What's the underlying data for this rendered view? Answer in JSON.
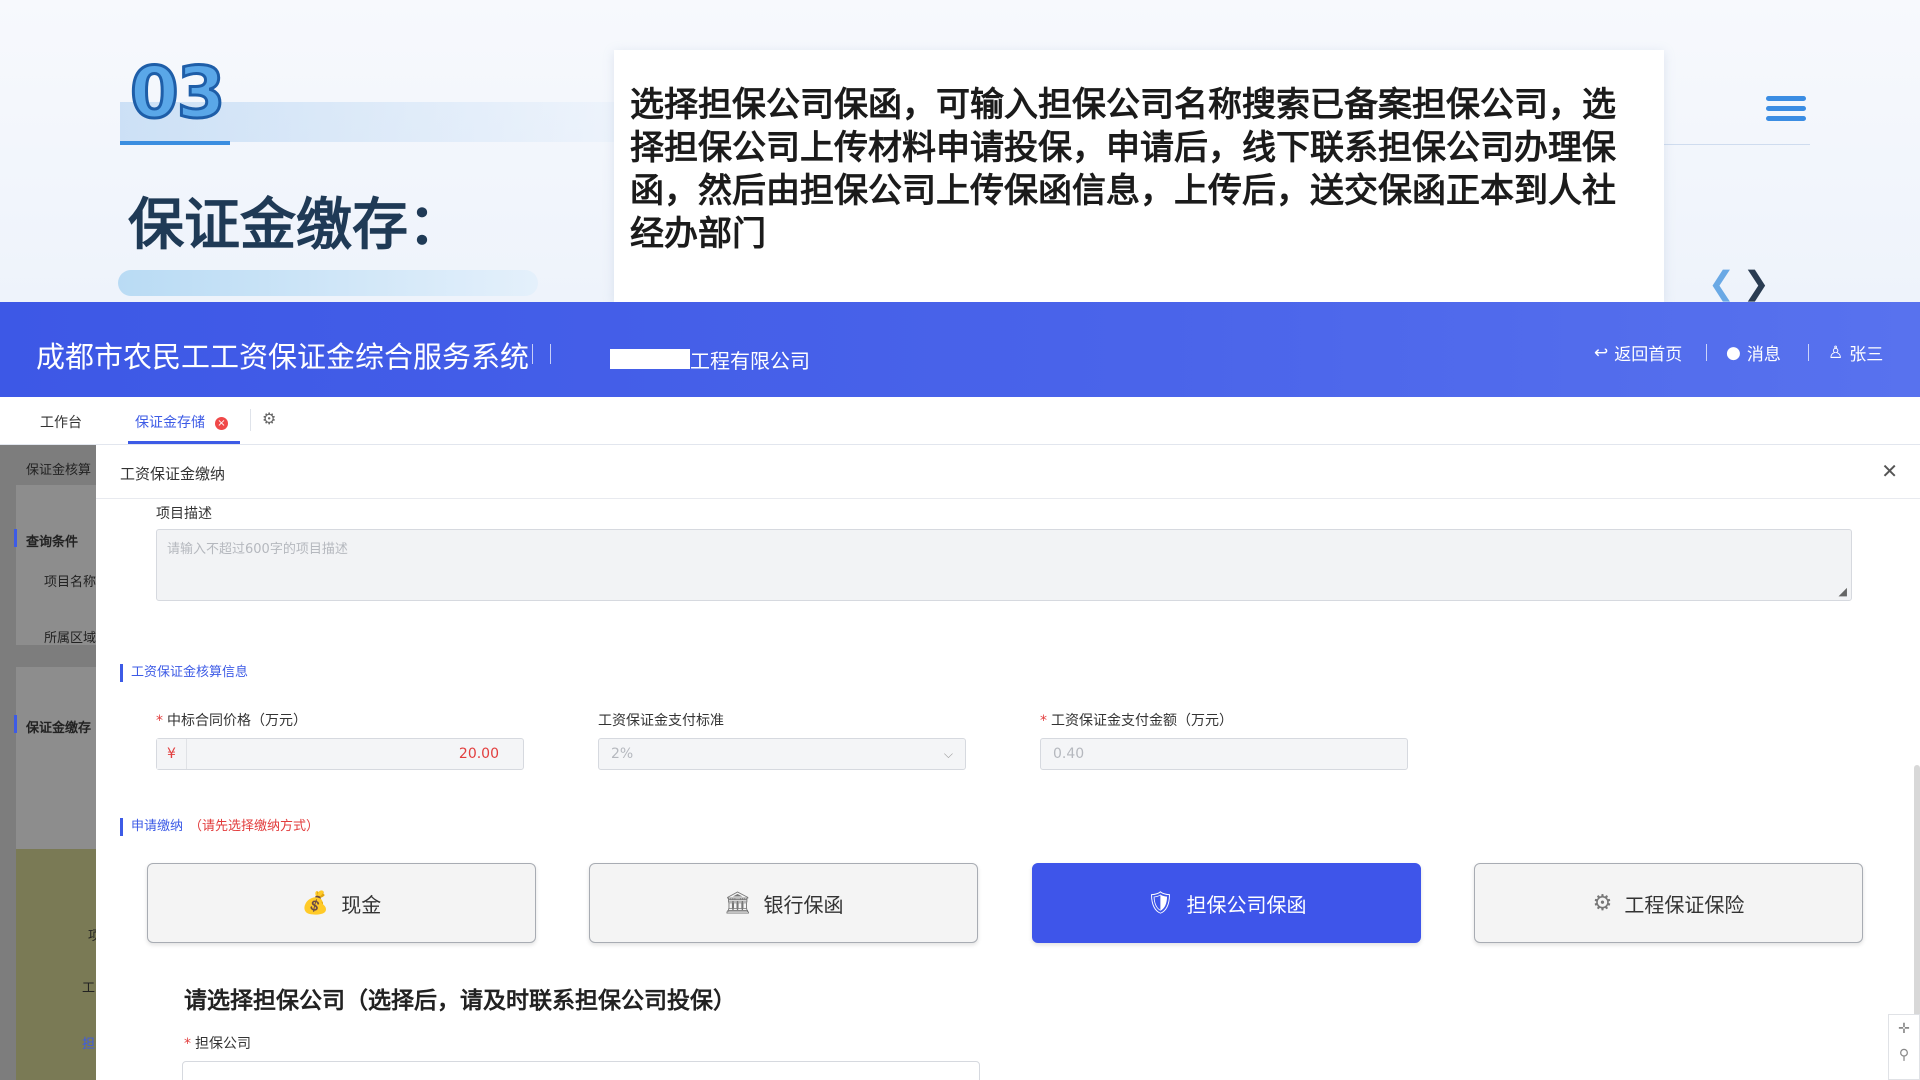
{
  "slide": {
    "number": "03",
    "title": "保证金缴存：",
    "description": "选择担保公司保函，可输入担保公司名称搜索已备案担保公司，选择担保公司上传材料申请投保，申请后，线下联系担保公司办理保函，然后由担保公司上传保函信息，上传后，送交保函正本到人社经办部门"
  },
  "app": {
    "system_title": "成都市农民工工资保证金综合服务系统",
    "company": "工程有限公司",
    "links": {
      "home": "返回首页",
      "messages": "消息",
      "user": "张三"
    }
  },
  "tabs": [
    {
      "label": "工作台"
    },
    {
      "label": "保证金存储"
    }
  ],
  "background_page": {
    "items": [
      "保证金核算",
      "查询条件",
      "项目名称",
      "所属区域",
      "保证金缴存",
      "项",
      "工",
      "担"
    ]
  },
  "modal": {
    "title": "工资保证金缴纳",
    "project_desc_label": "项目描述",
    "project_desc_placeholder": "请输入不超过600字的项目描述",
    "calc_section": "工资保证金核算信息",
    "contract_price_label": "中标合同价格（万元）",
    "currency_symbol": "¥",
    "contract_price_value": "20.00",
    "standard_label": "工资保证金支付标准",
    "standard_value": "2%",
    "amount_label": "工资保证金支付金额（万元）",
    "amount_value": "0.40",
    "apply_section": "申请缴纳",
    "apply_hint": "（请先选择缴纳方式）",
    "payment_methods": [
      {
        "label": "现金",
        "icon": "money-bag-icon",
        "active": false
      },
      {
        "label": "银行保函",
        "icon": "bank-icon",
        "active": false
      },
      {
        "label": "担保公司保函",
        "icon": "shield-icon",
        "active": true
      },
      {
        "label": "工程保证保险",
        "icon": "insurance-icon",
        "active": false
      }
    ],
    "choose_title": "请选择担保公司（选择后，请及时联系担保公司投保）",
    "guarantor_label": "担保公司"
  },
  "colors": {
    "primary": "#3e55ea",
    "required": "#e23d3d",
    "slide_title": "#1f3a56"
  }
}
